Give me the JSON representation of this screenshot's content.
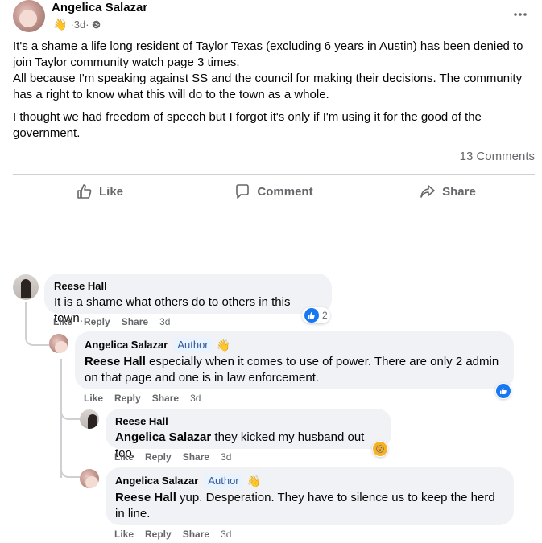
{
  "post": {
    "author": "Angelica Salazar",
    "badge_icon": "wave-hand-icon",
    "time": "3d",
    "visibility_icon": "globe-icon",
    "paragraphs": [
      "It's a shame a life long resident of Taylor Texas (excluding 6 years in Austin) has been denied to join Taylor community watch page 3 times.",
      "All because I'm speaking against SS and the council for making their decisions. The community has a right to know what this will do to the town as a whole.",
      "I thought we had freedom of speech but I forgot it's only if I'm using it for the good of the government."
    ],
    "comments_count": "13 Comments"
  },
  "actions": {
    "like": "Like",
    "comment": "Comment",
    "share": "Share"
  },
  "comment_actions": {
    "like": "Like",
    "reply": "Reply",
    "share": "Share"
  },
  "comments": [
    {
      "author": "Reese Hall",
      "text": "It is a shame what others do to others in this town.",
      "time": "3d",
      "reaction_count": "2"
    },
    {
      "author": "Angelica Salazar",
      "badge": "Author",
      "mention": "Reese Hall",
      "text": " especially when it comes to use of power. There are only 2 admin on that page and one is in law enforcement.",
      "time": "3d"
    },
    {
      "author": "Reese Hall",
      "mention": "Angelica Salazar",
      "text": " they kicked my husband out too.",
      "time": "3d"
    },
    {
      "author": "Angelica Salazar",
      "badge": "Author",
      "mention": "Reese Hall",
      "text": " yup. Desperation. They have to silence us to keep the herd in line.",
      "time": "3d"
    }
  ],
  "colors": {
    "accent": "#1877f2",
    "bubble": "#f0f2f5",
    "secondary_text": "#65676b"
  }
}
